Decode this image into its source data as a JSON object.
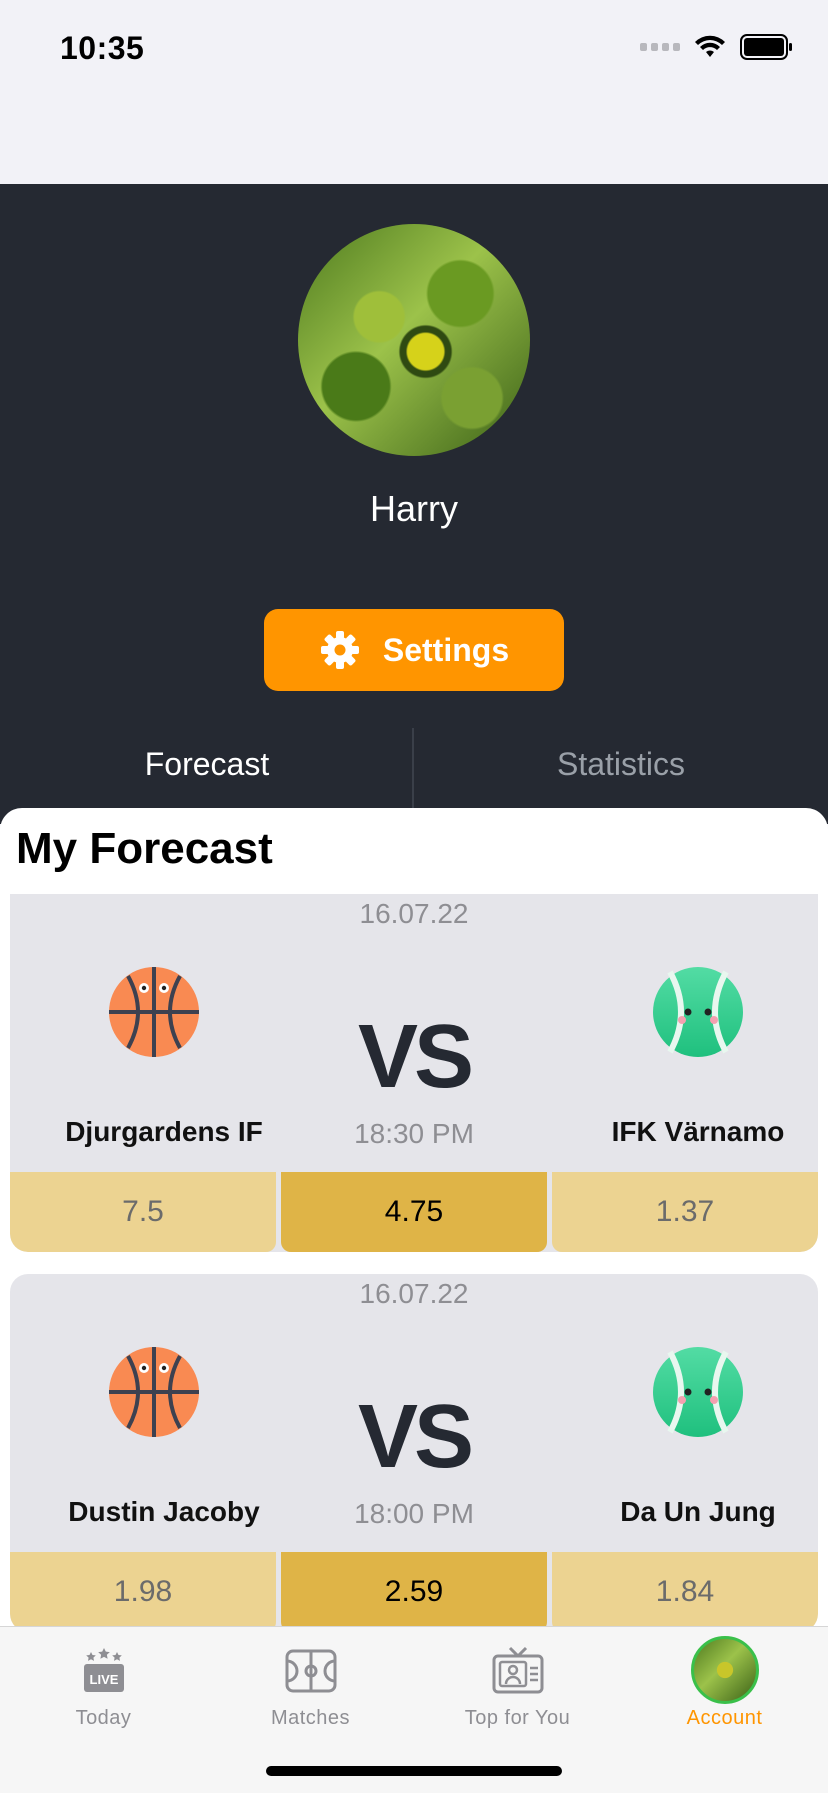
{
  "status_bar": {
    "time": "10:35"
  },
  "profile": {
    "name": "Harry",
    "settings_label": "Settings"
  },
  "tabs": [
    {
      "label": "Forecast",
      "active": true
    },
    {
      "label": "Statistics",
      "active": false
    }
  ],
  "forecast": {
    "title": "My Forecast",
    "matches": [
      {
        "date": "16.07.22",
        "time": "18:30 PM",
        "vs": "VS",
        "home": {
          "name": "Djurgardens IF",
          "icon": "basketball-icon"
        },
        "away": {
          "name": "IFK Värnamo",
          "icon": "tennis-ball-icon"
        },
        "odds": [
          "7.5",
          "4.75",
          "1.37"
        ]
      },
      {
        "date": "16.07.22",
        "time": "18:00 PM",
        "vs": "VS",
        "home": {
          "name": "Dustin Jacoby",
          "icon": "basketball-icon"
        },
        "away": {
          "name": "Da Un Jung",
          "icon": "tennis-ball-icon"
        },
        "odds": [
          "1.98",
          "2.59",
          "1.84"
        ]
      }
    ]
  },
  "tabbar": [
    {
      "label": "Today",
      "icon": "live-icon",
      "active": false
    },
    {
      "label": "Matches",
      "icon": "court-icon",
      "active": false
    },
    {
      "label": "Top for You",
      "icon": "tv-icon",
      "active": false
    },
    {
      "label": "Account",
      "icon": "avatar",
      "active": true
    }
  ],
  "colors": {
    "accent": "#ff9500",
    "dark_bg": "#252932",
    "odds_light": "#ecd391",
    "odds_mid": "#dfb447"
  }
}
